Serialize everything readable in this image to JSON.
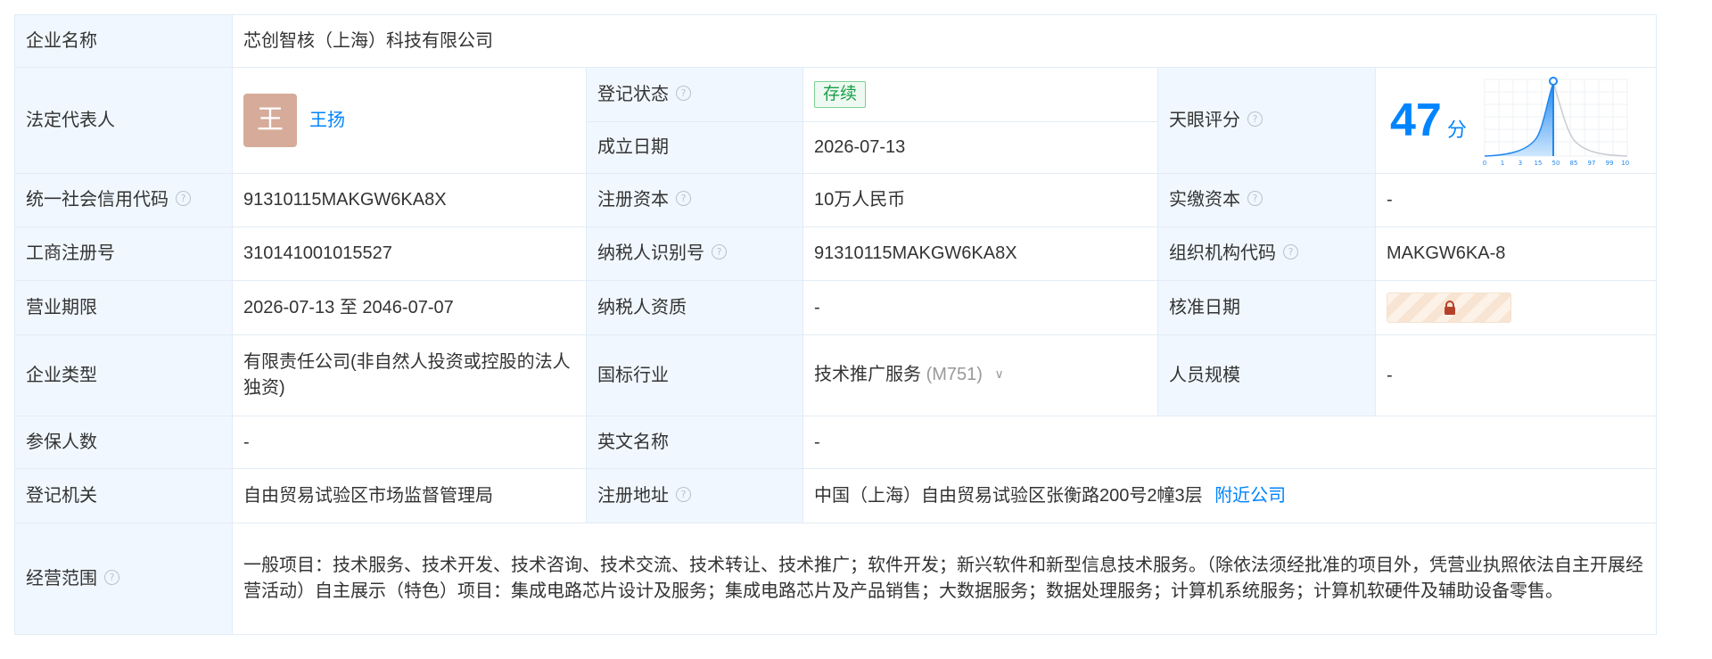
{
  "company": {
    "name_label": "企业名称",
    "name": "芯创智核（上海）科技有限公司"
  },
  "legal_rep": {
    "label": "法定代表人",
    "avatar_char": "王",
    "name": "王扬"
  },
  "reg_status": {
    "label": "登记状态",
    "value": "存续"
  },
  "found_date": {
    "label": "成立日期",
    "value": "2026-07-13"
  },
  "score": {
    "label": "天眼评分",
    "value": "47",
    "unit": "分",
    "ticks": [
      "0",
      "1",
      "3",
      "15",
      "50",
      "85",
      "97",
      "99",
      "100"
    ],
    "level": 47
  },
  "credit_code": {
    "label": "统一社会信用代码",
    "value": "91310115MAKGW6KA8X"
  },
  "reg_capital": {
    "label": "注册资本",
    "value": "10万人民币"
  },
  "paid_capital": {
    "label": "实缴资本",
    "value": "-"
  },
  "biz_reg_no": {
    "label": "工商注册号",
    "value": "310141001015527"
  },
  "taxpayer_id": {
    "label": "纳税人识别号",
    "value": "91310115MAKGW6KA8X"
  },
  "org_code": {
    "label": "组织机构代码",
    "value": "MAKGW6KA-8"
  },
  "biz_term": {
    "label": "营业期限",
    "value": "2026-07-13 至 2046-07-07"
  },
  "tax_qual": {
    "label": "纳税人资质",
    "value": "-"
  },
  "approve_date": {
    "label": "核准日期"
  },
  "company_type": {
    "label": "企业类型",
    "value": "有限责任公司(非自然人投资或控股的法人独资)"
  },
  "industry": {
    "label": "国标行业",
    "value": "技术推广服务",
    "code": "(M751)"
  },
  "staff_size": {
    "label": "人员规模",
    "value": "-"
  },
  "insured": {
    "label": "参保人数",
    "value": "-"
  },
  "english_name": {
    "label": "英文名称",
    "value": "-"
  },
  "reg_authority": {
    "label": "登记机关",
    "value": "自由贸易试验区市场监督管理局"
  },
  "reg_address": {
    "label": "注册地址",
    "value": "中国（上海）自由贸易试验区张衡路200号2幢3层",
    "nearby_link": "附近公司"
  },
  "scope": {
    "label": "经营范围",
    "value": "一般项目：技术服务、技术开发、技术咨询、技术交流、技术转让、技术推广；软件开发；新兴软件和新型信息技术服务。（除依法须经批准的项目外，凭营业执照依法自主开展经营活动）自主展示（特色）项目：集成电路芯片设计及服务；集成电路芯片及产品销售；大数据服务；数据处理服务；计算机系统服务；计算机软硬件及辅助设备零售。"
  },
  "colors": {
    "label_bg": "#f0f7fe",
    "border": "#e2ecf5",
    "link": "#0084ff",
    "status_green": "#1a9e4a",
    "avatar": "#d6ab99"
  }
}
